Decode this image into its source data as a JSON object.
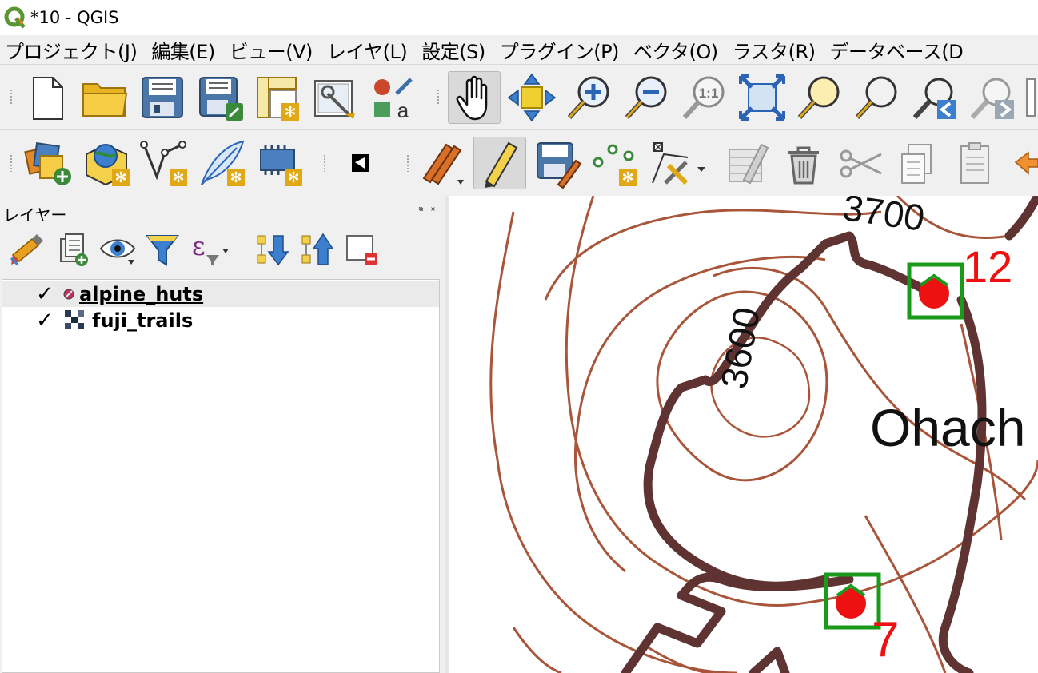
{
  "window": {
    "title": "*10 - QGIS"
  },
  "menubar": {
    "items": [
      "プロジェクト(J)",
      "編集(E)",
      "ビュー(V)",
      "レイヤ(L)",
      "設定(S)",
      "プラグイン(P)",
      "ベクタ(O)",
      "ラスタ(R)",
      "データベース(D"
    ]
  },
  "toolbar1": {
    "icons": [
      "new-project-icon",
      "open-project-icon",
      "save-project-icon",
      "save-as-icon",
      "print-layout-icon",
      "layout-manager-icon",
      "style-manager-icon",
      "pan-icon",
      "pan-to-selection-icon",
      "zoom-in-icon",
      "zoom-out-icon",
      "zoom-native-icon",
      "zoom-full-icon",
      "zoom-to-selection-icon",
      "zoom-to-layer-icon",
      "zoom-last-icon",
      "zoom-next-icon"
    ]
  },
  "toolbar2": {
    "icons": [
      "data-source-manager-icon",
      "new-geopackage-icon",
      "new-shapefile-icon",
      "new-temp-scratch-icon",
      "new-virtual-layer-icon",
      "plugin-icon",
      "edits-icon",
      "toggle-editing-icon",
      "save-edits-icon",
      "add-point-feature-icon",
      "vertex-tool-icon",
      "modify-attributes-icon",
      "delete-selected-icon",
      "cut-features-icon",
      "copy-features-icon",
      "paste-features-icon",
      "undo-icon"
    ]
  },
  "layers_panel": {
    "title": "レイヤー",
    "layers": [
      {
        "name": "alpine_huts",
        "checked": "✓",
        "selected": true
      },
      {
        "name": "fuji_trails",
        "checked": "✓",
        "selected": false
      }
    ]
  },
  "map": {
    "labels": {
      "contour_top": "3700",
      "contour_mid": "3600",
      "place_name": "Ohach",
      "hut_a": "12",
      "hut_b": "7"
    },
    "colors": {
      "contour_thin": "#a9553a",
      "trail": "#5e3331",
      "hut_marker": "#ee1111",
      "hut_frame": "#1a9a1a",
      "hut_label": "#ee1111"
    }
  }
}
